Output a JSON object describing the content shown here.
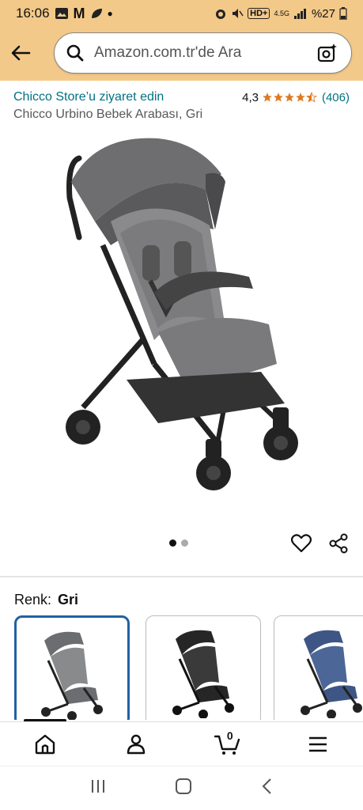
{
  "status_bar": {
    "time": "16:06",
    "battery": "%27",
    "network": "4.5G"
  },
  "search": {
    "placeholder": "Amazon.com.tr'de Ara"
  },
  "product": {
    "store_link": "Chicco Store’u ziyaret edin",
    "rating_value": "4,3",
    "rating_stars": 4.3,
    "rating_count": "(406)",
    "title": "Chicco Urbino Bebek Arabası, Gri"
  },
  "gallery": {
    "total_images": 2,
    "current_index": 0
  },
  "color": {
    "label": "Renk:",
    "selected": "Gri",
    "options": [
      {
        "name": "Gri",
        "hex": "#6b6d70",
        "selected": true
      },
      {
        "name": "Siyah",
        "hex": "#262626",
        "selected": false
      },
      {
        "name": "Mavi",
        "hex": "#3e5685",
        "selected": false
      }
    ]
  },
  "bottom_nav": {
    "cart_count": "0",
    "items": [
      "home",
      "account",
      "cart",
      "menu"
    ]
  },
  "colors": {
    "header_bg": "#f3c989",
    "link": "#007185",
    "star": "#de7921",
    "selected_border": "#2162a1"
  }
}
